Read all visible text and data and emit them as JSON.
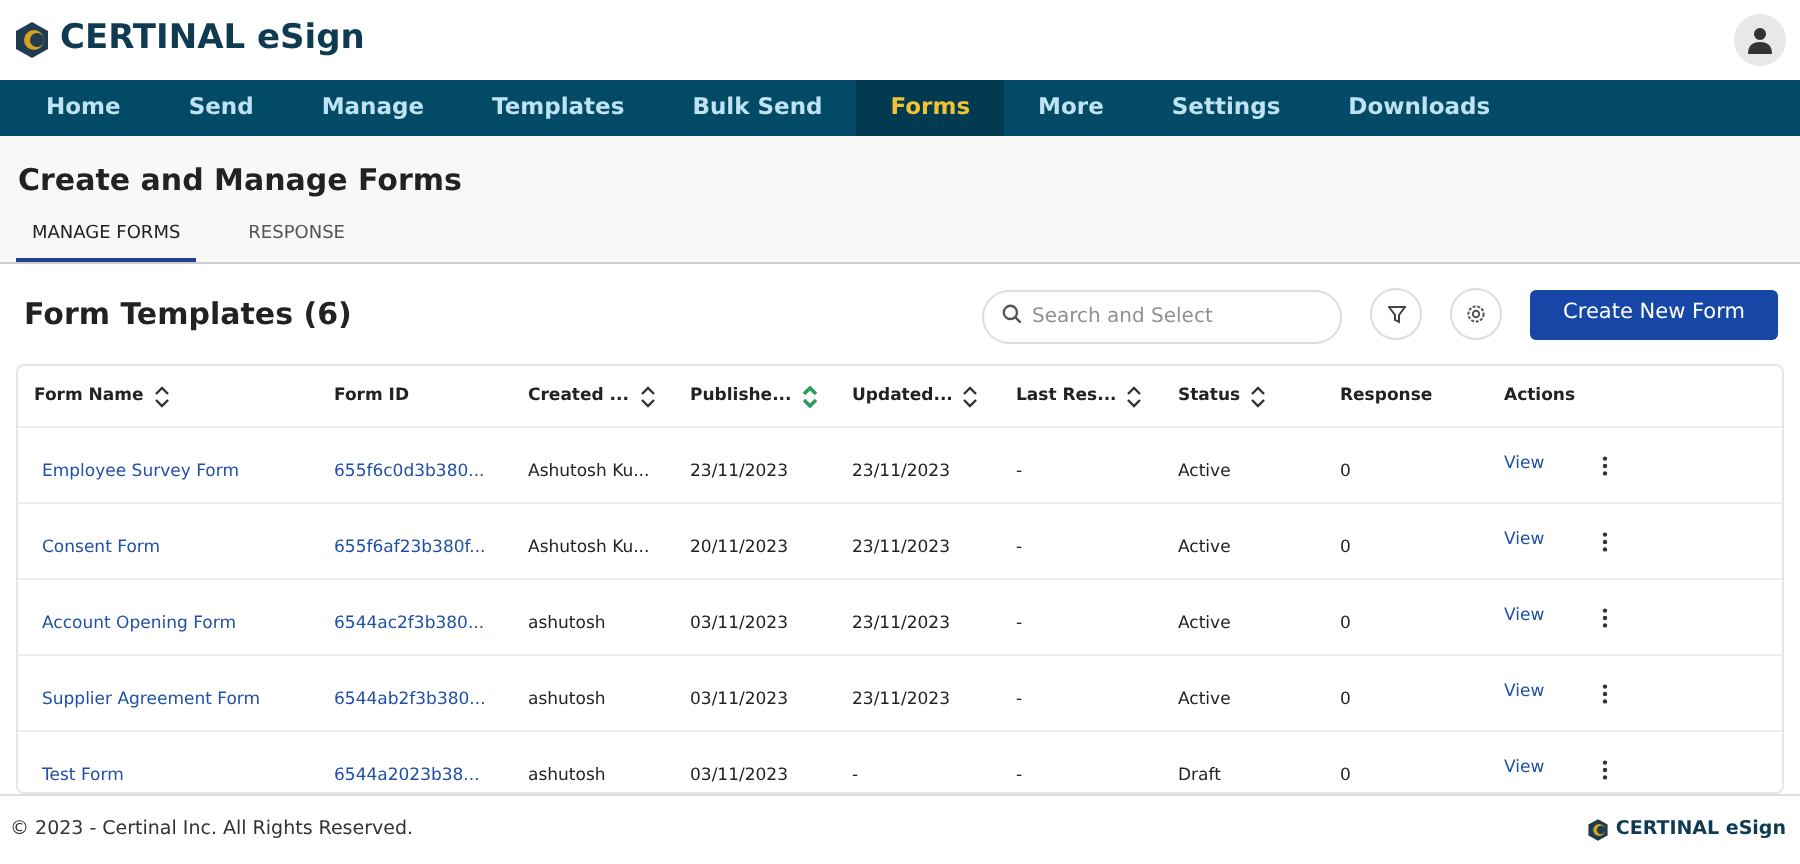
{
  "brand": {
    "name": "CERTINAL eSign"
  },
  "nav": [
    {
      "label": "Home",
      "selected": false
    },
    {
      "label": "Send",
      "selected": false
    },
    {
      "label": "Manage",
      "selected": false
    },
    {
      "label": "Templates",
      "selected": false
    },
    {
      "label": "Bulk Send",
      "selected": false
    },
    {
      "label": "Forms",
      "selected": true
    },
    {
      "label": "More",
      "selected": false
    },
    {
      "label": "Settings",
      "selected": false
    },
    {
      "label": "Downloads",
      "selected": false
    }
  ],
  "page_title": "Create and Manage Forms",
  "tabs": [
    {
      "label": "MANAGE FORMS",
      "selected": true
    },
    {
      "label": "RESPONSE",
      "selected": false
    }
  ],
  "section_title": "Form Templates (6)",
  "search": {
    "placeholder": "Search and Select"
  },
  "create_button": "Create New Form",
  "table": {
    "columns": [
      {
        "label": "Form Name",
        "sortable": true,
        "sorted": false
      },
      {
        "label": "Form ID",
        "sortable": false
      },
      {
        "label": "Created ...",
        "sortable": true,
        "sorted": false
      },
      {
        "label": "Publishe...",
        "sortable": true,
        "sorted": true
      },
      {
        "label": "Updated...",
        "sortable": true,
        "sorted": false
      },
      {
        "label": "Last Res...",
        "sortable": true,
        "sorted": false
      },
      {
        "label": "Status",
        "sortable": true,
        "sorted": false
      },
      {
        "label": "Response",
        "sortable": false
      },
      {
        "label": "Actions",
        "sortable": false
      }
    ],
    "rows": [
      {
        "name": "Employee Survey Form",
        "id": "655f6c0d3b380...",
        "created_by": "Ashutosh Ku...",
        "published": "23/11/2023",
        "updated": "23/11/2023",
        "last_response": "-",
        "status": "Active",
        "response": "0",
        "action": "View"
      },
      {
        "name": "Consent Form",
        "id": "655f6af23b380f...",
        "created_by": "Ashutosh Ku...",
        "published": "20/11/2023",
        "updated": "23/11/2023",
        "last_response": "-",
        "status": "Active",
        "response": "0",
        "action": "View"
      },
      {
        "name": "Account Opening Form",
        "id": "6544ac2f3b380...",
        "created_by": "ashutosh",
        "published": "03/11/2023",
        "updated": "23/11/2023",
        "last_response": "-",
        "status": "Active",
        "response": "0",
        "action": "View"
      },
      {
        "name": "Supplier Agreement Form",
        "id": "6544ab2f3b380...",
        "created_by": "ashutosh",
        "published": "03/11/2023",
        "updated": "23/11/2023",
        "last_response": "-",
        "status": "Active",
        "response": "0",
        "action": "View"
      },
      {
        "name": "Test Form",
        "id": "6544a2023b38...",
        "created_by": "ashutosh",
        "published": "03/11/2023",
        "updated": "-",
        "last_response": "-",
        "status": "Draft",
        "response": "0",
        "action": "View"
      }
    ]
  },
  "footer": {
    "copyright": "© 2023 - Certinal Inc. All Rights Reserved.",
    "brand": "CERTINAL eSign"
  }
}
